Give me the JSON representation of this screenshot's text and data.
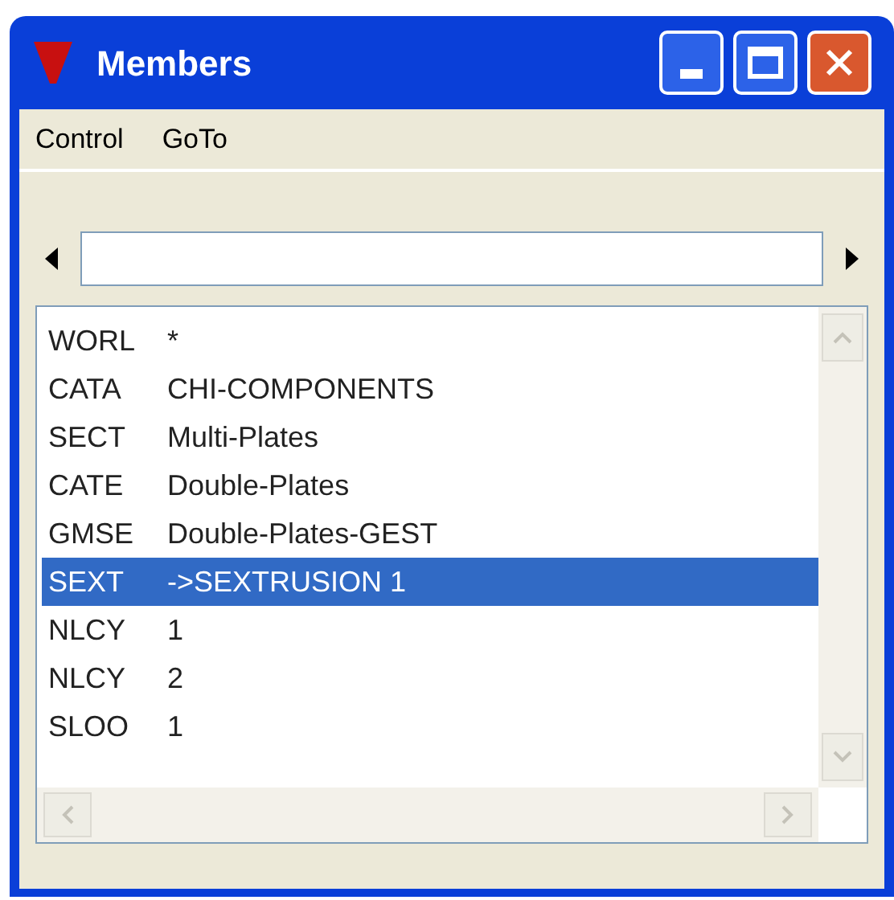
{
  "window": {
    "title": "Members"
  },
  "menu": [
    "Control",
    "GoTo"
  ],
  "list": [
    {
      "code": "WORL",
      "value": "*",
      "selected": false
    },
    {
      "code": "CATA",
      "value": "CHI-COMPONENTS",
      "selected": false
    },
    {
      "code": "SECT",
      "value": "Multi-Plates",
      "selected": false
    },
    {
      "code": "CATE",
      "value": "Double-Plates",
      "selected": false
    },
    {
      "code": "GMSE",
      "value": "Double-Plates-GEST",
      "selected": false
    },
    {
      "code": "SEXT",
      "value": "->SEXTRUSION 1",
      "selected": true
    },
    {
      "code": "NLCY",
      "value": "1",
      "selected": false
    },
    {
      "code": "NLCY",
      "value": "2",
      "selected": false
    },
    {
      "code": "SLOO",
      "value": "1",
      "selected": false
    }
  ]
}
